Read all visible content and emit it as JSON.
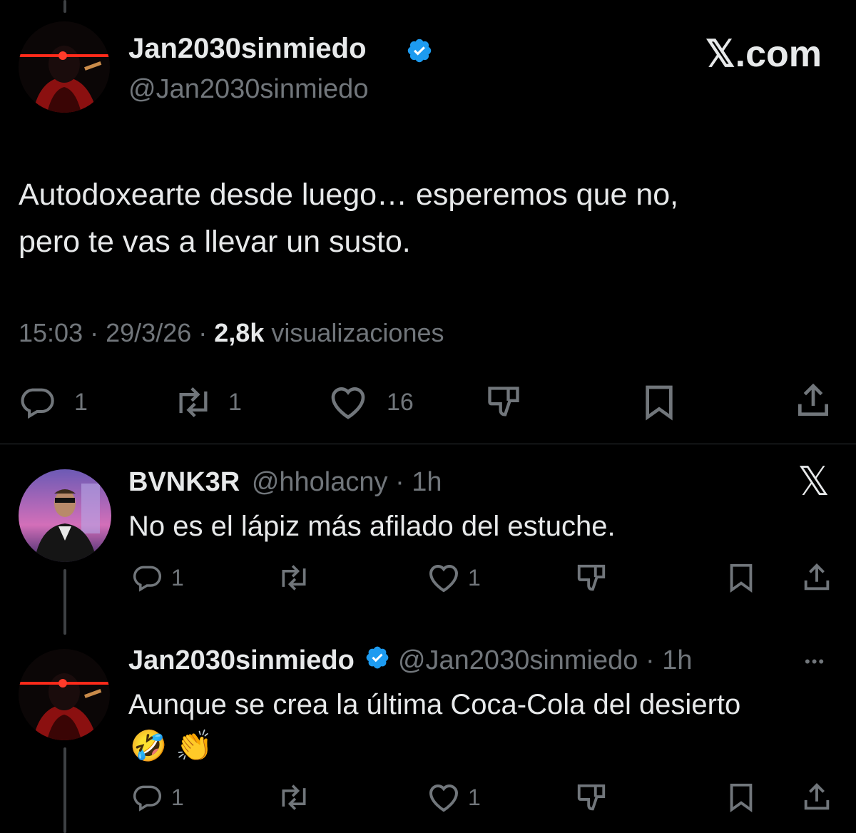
{
  "brand": {
    "logo_text": "𝕏.com"
  },
  "main_tweet": {
    "display_name": "Jan2030sinmiedo",
    "handle": "@Jan2030sinmiedo",
    "text_line1": "Autodoxearte desde luego… esperemos que no,",
    "text_line2": "pero te vas a llevar un susto.",
    "time": "15:03",
    "date": "29/3/26",
    "views_count": "2,8k",
    "views_label": "visualizaciones",
    "sep": "·",
    "replies": "1",
    "reposts": "1",
    "likes": "16"
  },
  "reply1": {
    "display_name": "BVNK3R",
    "handle": "@hholacny",
    "sep": "·",
    "time": "1h",
    "text": "No es el lápiz más afilado del estuche.",
    "replies": "1",
    "likes": "1",
    "close_glyph": "𝕏"
  },
  "reply2": {
    "display_name": "Jan2030sinmiedo",
    "handle": "@Jan2030sinmiedo",
    "sep": "·",
    "time": "1h",
    "text": "Aunque se crea la última Coca-Cola del desierto",
    "emoji": "🤣 👏",
    "more": "•••",
    "replies": "1",
    "likes": "1"
  },
  "colors": {
    "background": "#000000",
    "text": "#e7e9ea",
    "muted": "#71767b",
    "verified": "#1d9bf0",
    "divider": "#2f3336"
  }
}
